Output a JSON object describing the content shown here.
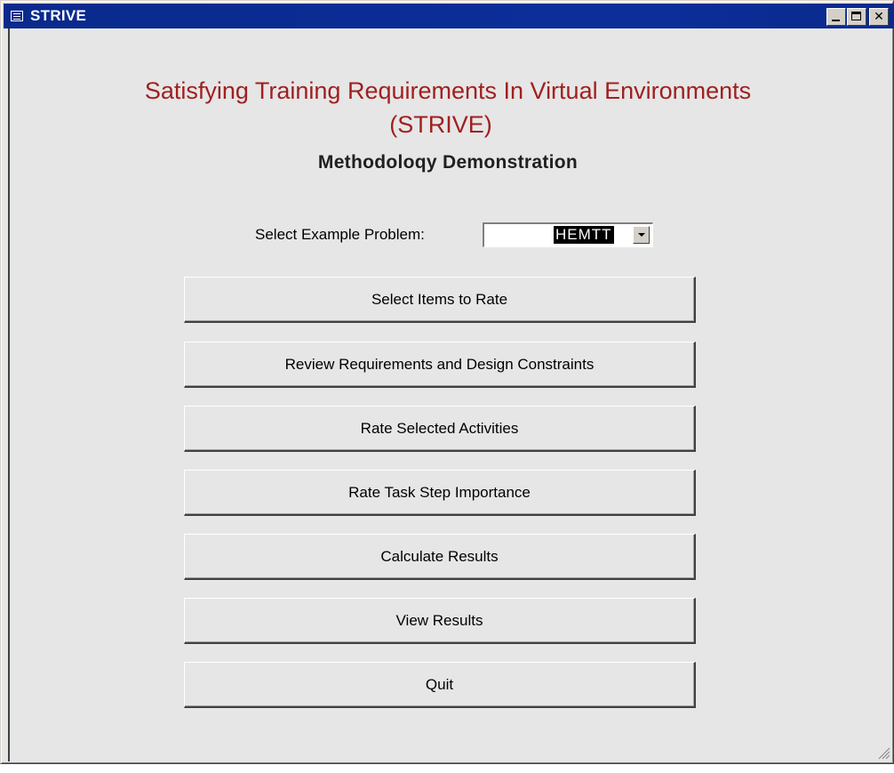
{
  "window": {
    "title": "STRIVE",
    "icon": "form-icon",
    "controls": {
      "minimize": "minimize-icon",
      "maximize": "maximize-icon",
      "close_label": "✕"
    }
  },
  "form": {
    "heading_line1": "Satisfying Training Requirements In Virtual Environments",
    "heading_line2": "(STRIVE)",
    "subheading": "Methodoloqy Demonstration",
    "heading_color": "#a02020"
  },
  "example_problem": {
    "label": "Select Example Problem:",
    "selected_value": "HEMTT"
  },
  "buttons": [
    {
      "label": "Select Items to Rate"
    },
    {
      "label": "Review Requirements and Design Constraints"
    },
    {
      "label": "Rate Selected Activities"
    },
    {
      "label": "Rate Task Step Importance"
    },
    {
      "label": "Calculate Results"
    },
    {
      "label": "View Results"
    },
    {
      "label": "Quit"
    }
  ]
}
